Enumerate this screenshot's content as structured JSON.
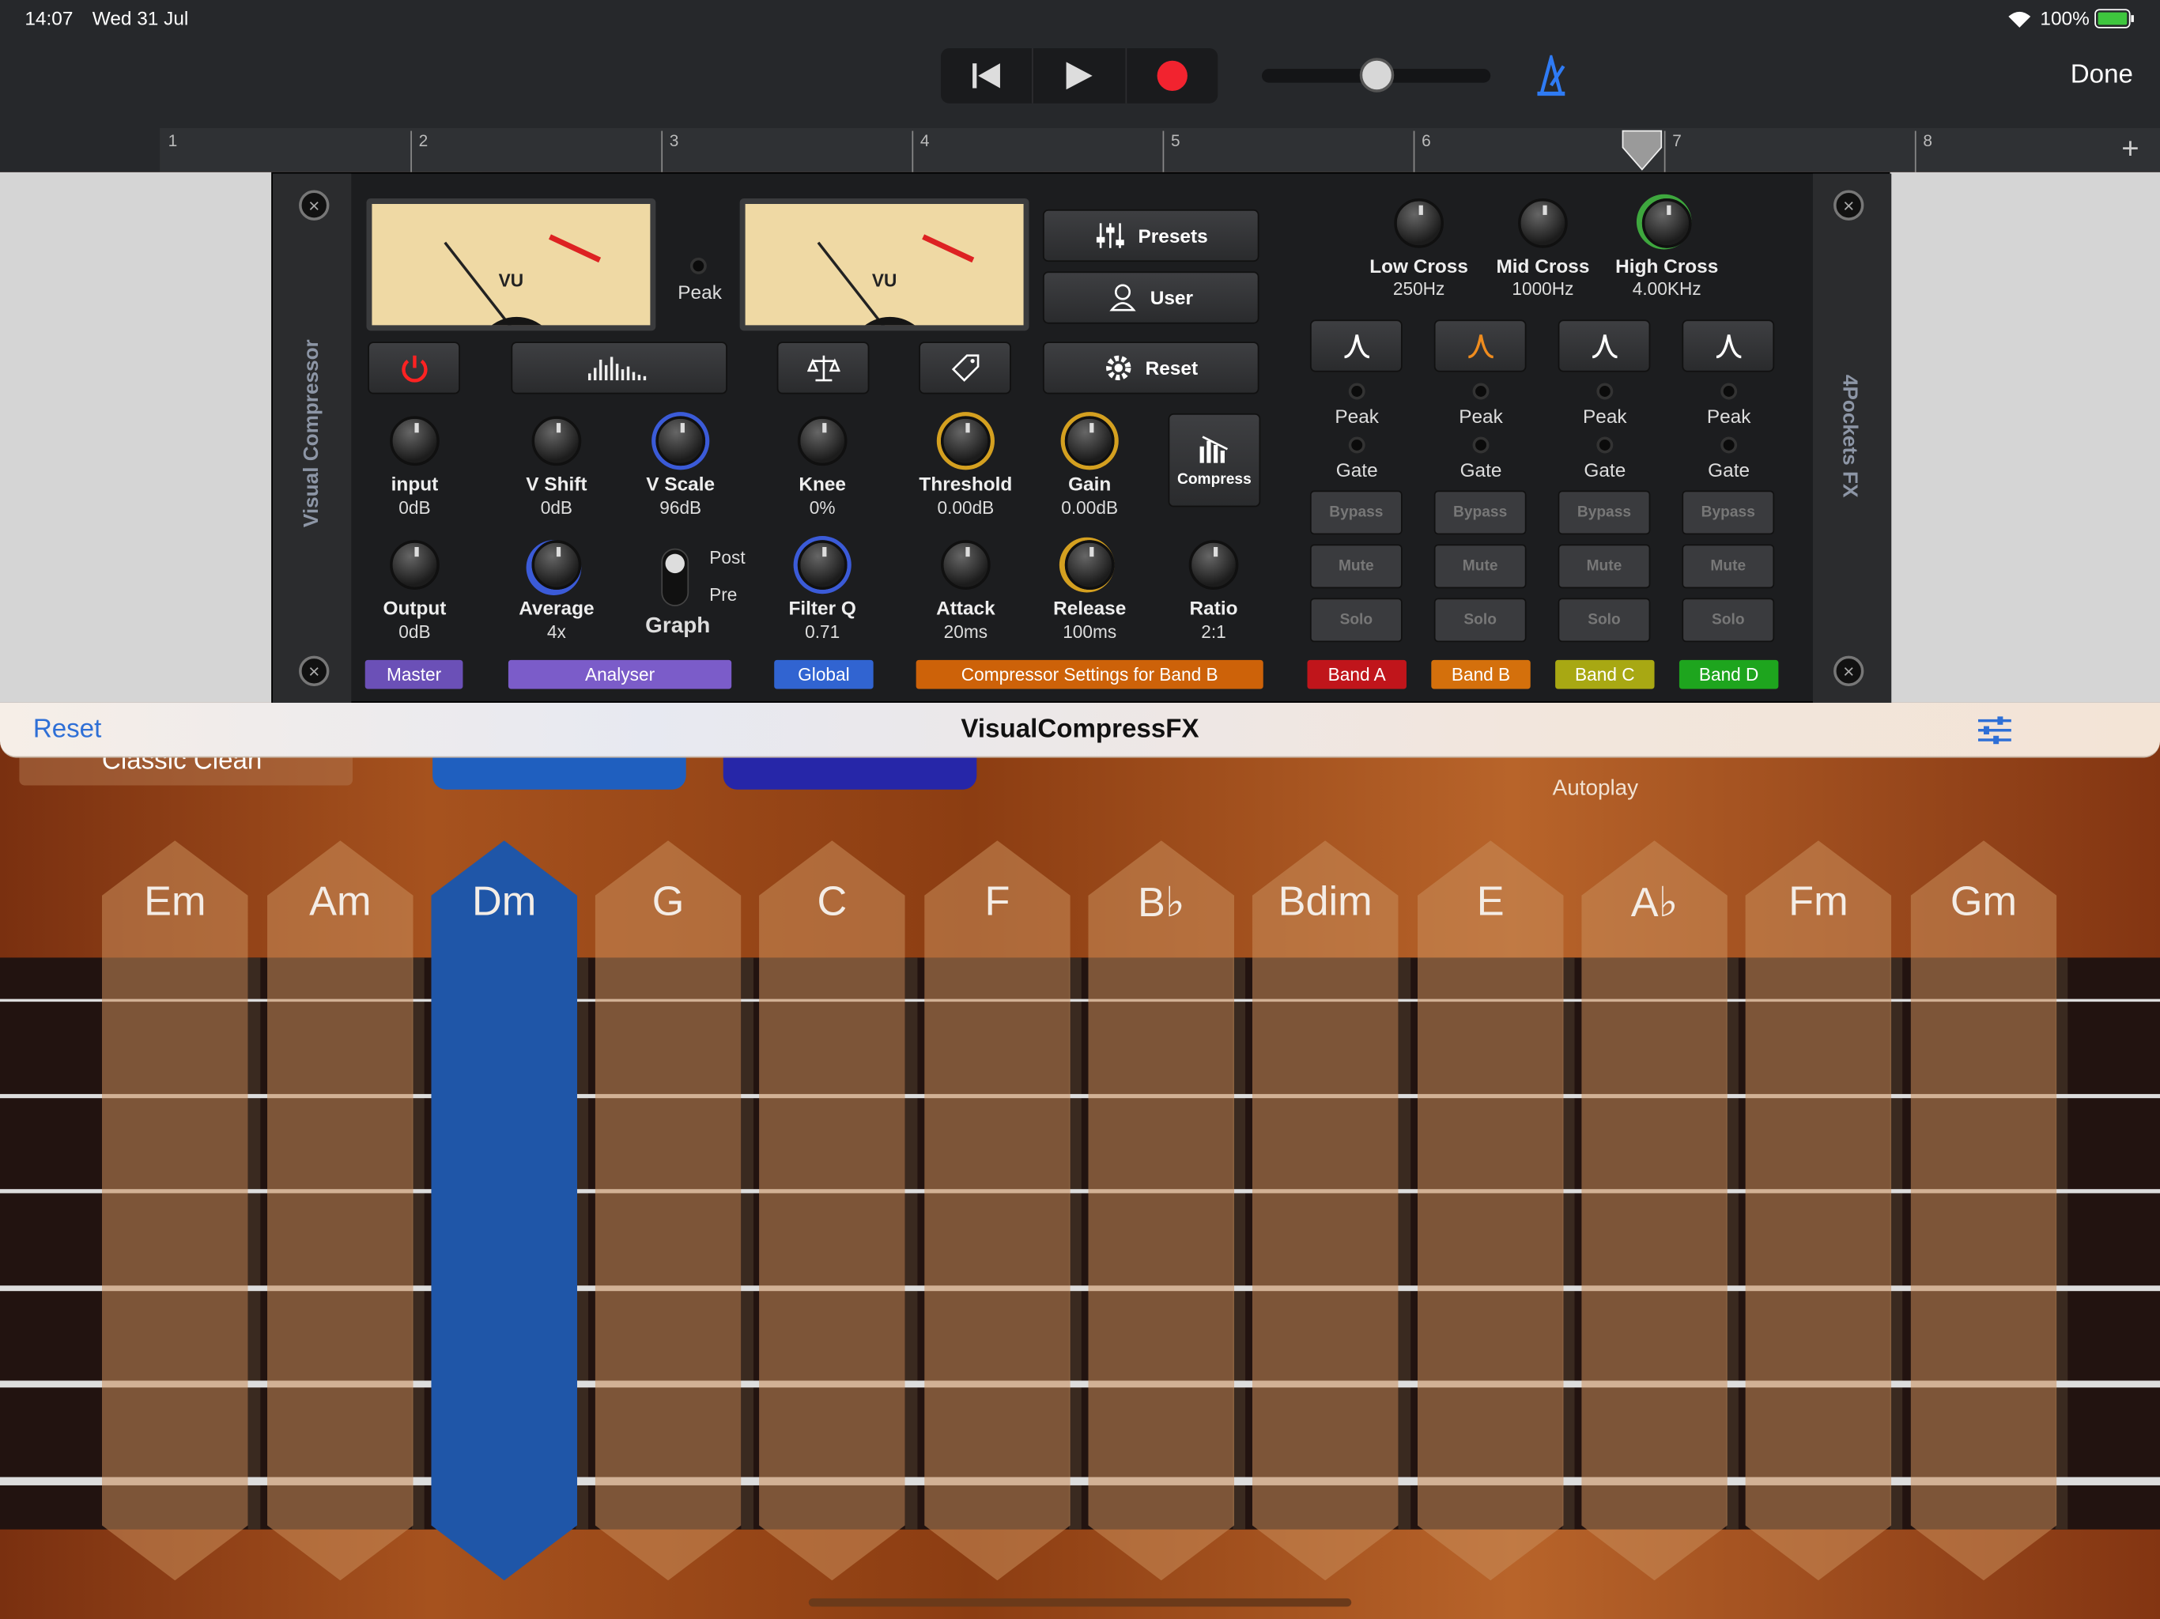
{
  "status": {
    "time": "14:07",
    "date": "Wed 31 Jul",
    "battery": "100%"
  },
  "toolbar": {
    "done_label": "Done",
    "icons": [
      "skip-back-icon",
      "play-icon",
      "record-icon",
      "metronome-icon"
    ]
  },
  "ruler": {
    "marks": [
      "1",
      "2",
      "3",
      "4",
      "5",
      "6",
      "7",
      "8"
    ]
  },
  "plugin": {
    "left_rail_label": "Visual Compressor",
    "right_rail_label": "4Pockets FX",
    "peak_label": "Peak",
    "vu_label": "VU",
    "presets_label": "Presets",
    "user_label": "User",
    "reset_label": "Reset",
    "compress_label": "Compress",
    "knobs": {
      "input": {
        "name": "input",
        "value": "0dB"
      },
      "vshift": {
        "name": "V Shift",
        "value": "0dB"
      },
      "vscale": {
        "name": "V Scale",
        "value": "96dB"
      },
      "knee": {
        "name": "Knee",
        "value": "0%"
      },
      "threshold": {
        "name": "Threshold",
        "value": "0.00dB"
      },
      "gain": {
        "name": "Gain",
        "value": "0.00dB"
      },
      "output": {
        "name": "Output",
        "value": "0dB"
      },
      "average": {
        "name": "Average",
        "value": "4x"
      },
      "filterq": {
        "name": "Filter Q",
        "value": "0.71"
      },
      "attack": {
        "name": "Attack",
        "value": "20ms"
      },
      "release": {
        "name": "Release",
        "value": "100ms"
      },
      "ratio": {
        "name": "Ratio",
        "value": "2:1"
      },
      "lowcross": {
        "name": "Low Cross",
        "value": "250Hz"
      },
      "midcross": {
        "name": "Mid Cross",
        "value": "1000Hz"
      },
      "highcross": {
        "name": "High Cross",
        "value": "4.00KHz"
      }
    },
    "graph": {
      "post": "Post",
      "pre": "Pre",
      "label": "Graph"
    },
    "bands": [
      {
        "peak": "Peak",
        "gate": "Gate",
        "bypass": "Bypass",
        "mute": "Mute",
        "solo": "Solo",
        "tag": "Band A",
        "color": "#c0151b"
      },
      {
        "peak": "Peak",
        "gate": "Gate",
        "bypass": "Bypass",
        "mute": "Mute",
        "solo": "Solo",
        "tag": "Band B",
        "color": "#d4700c"
      },
      {
        "peak": "Peak",
        "gate": "Gate",
        "bypass": "Bypass",
        "mute": "Mute",
        "solo": "Solo",
        "tag": "Band C",
        "color": "#a8a813"
      },
      {
        "peak": "Peak",
        "gate": "Gate",
        "bypass": "Bypass",
        "mute": "Mute",
        "solo": "Solo",
        "tag": "Band D",
        "color": "#1ea51e"
      }
    ],
    "tags": {
      "master": "Master",
      "analyser": "Analyser",
      "global": "Global",
      "comp": "Compressor Settings for Band B"
    }
  },
  "fxbar": {
    "reset_label": "Reset",
    "title": "VisualCompressFX"
  },
  "guitar": {
    "preset_name": "Classic Clean",
    "autoplay_label": "Autoplay",
    "chords": [
      "Em",
      "Am",
      "Dm",
      "G",
      "C",
      "F",
      "B♭",
      "Bdim",
      "E",
      "A♭",
      "Fm",
      "Gm"
    ],
    "selected_chord": "Dm"
  }
}
